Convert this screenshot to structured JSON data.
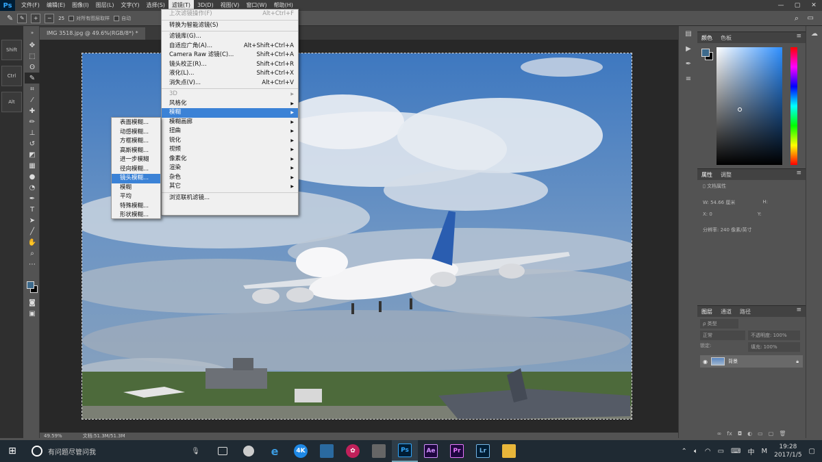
{
  "menubar": {
    "logo": "Ps",
    "items": [
      "文件(F)",
      "编辑(E)",
      "图像(I)",
      "图层(L)",
      "文字(Y)",
      "选择(S)",
      "滤镜(T)",
      "3D(D)",
      "视图(V)",
      "窗口(W)",
      "帮助(H)"
    ],
    "window_controls": [
      "—",
      "▢",
      "✕"
    ]
  },
  "options": {
    "brush_size": "25",
    "sample_all": "对所有图层取样",
    "auto_enhance": "自动"
  },
  "modifiers": [
    "Shift",
    "Ctrl",
    "Alt"
  ],
  "document": {
    "tab_label": "IMG 3518.jpg @ 49.6%(RGB/8*) *",
    "zoom": "49.59%",
    "doc_size": "文档:51.3M/51.3M"
  },
  "filter_menu": {
    "items": [
      {
        "label": "上次滤镜操作(F)",
        "shortcut": "Alt+Ctrl+F",
        "disabled": true
      },
      {
        "sep": true
      },
      {
        "label": "转换为智能滤镜(S)",
        "shortcut": ""
      },
      {
        "sep": true
      },
      {
        "label": "滤镜库(G)...",
        "shortcut": ""
      },
      {
        "label": "自适应广角(A)...",
        "shortcut": "Alt+Shift+Ctrl+A"
      },
      {
        "label": "Camera Raw 滤镜(C)...",
        "shortcut": "Shift+Ctrl+A"
      },
      {
        "label": "镜头校正(R)...",
        "shortcut": "Shift+Ctrl+R"
      },
      {
        "label": "液化(L)...",
        "shortcut": "Shift+Ctrl+X"
      },
      {
        "label": "消失点(V)...",
        "shortcut": "Alt+Ctrl+V"
      },
      {
        "sep": true
      },
      {
        "label": "3D",
        "shortcut": "",
        "disabled": true,
        "sub": true
      },
      {
        "label": "风格化",
        "shortcut": "",
        "sub": true
      },
      {
        "label": "模糊",
        "shortcut": "",
        "sub": true,
        "highlight": true
      },
      {
        "label": "模糊画廊",
        "shortcut": "",
        "sub": true
      },
      {
        "label": "扭曲",
        "shortcut": "",
        "sub": true
      },
      {
        "label": "锐化",
        "shortcut": "",
        "sub": true
      },
      {
        "label": "视频",
        "shortcut": "",
        "sub": true
      },
      {
        "label": "像素化",
        "shortcut": "",
        "sub": true
      },
      {
        "label": "渲染",
        "shortcut": "",
        "sub": true
      },
      {
        "label": "杂色",
        "shortcut": "",
        "sub": true
      },
      {
        "label": "其它",
        "shortcut": "",
        "sub": true
      },
      {
        "sep": true
      },
      {
        "label": "浏览联机滤镜...",
        "shortcut": ""
      }
    ]
  },
  "blur_menu": {
    "items": [
      "表面模糊...",
      "动感模糊...",
      "方框模糊...",
      "高斯模糊...",
      "进一步模糊",
      "径向模糊...",
      "镜头模糊...",
      "模糊",
      "平均",
      "特殊模糊...",
      "形状模糊..."
    ],
    "highlight_index": 6
  },
  "color_panel": {
    "tabs": [
      "颜色",
      "色板"
    ],
    "fg": "#3d6a8c",
    "bg": "#000000"
  },
  "properties_panel": {
    "tabs": [
      "属性",
      "调整"
    ],
    "title": "文档属性",
    "w": "W:  54.66 厘米",
    "h": "H:",
    "x": "X:  0",
    "y": "Y:",
    "resolution": "分辨率: 240 像素/英寸"
  },
  "layers_panel": {
    "tabs": [
      "图层",
      "通道",
      "路径"
    ],
    "filter": "ρ 类型",
    "blend": "正常",
    "opacity": "不透明度: 100%",
    "lock": "锁定:",
    "fill": "填充: 100%",
    "layer_name": "背景"
  },
  "taskbar": {
    "search_placeholder": "有问题尽管问我",
    "apps": [
      "Ps",
      "Ae",
      "Pr",
      "Lr"
    ],
    "time": "19:28",
    "date": "2017/1/5",
    "ime": "中",
    "ime2": "M"
  }
}
